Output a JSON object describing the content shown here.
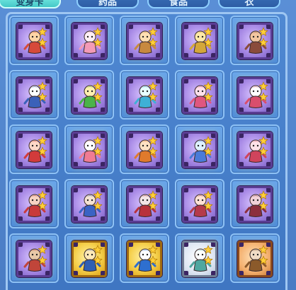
{
  "tabs": [
    {
      "label": "变身卡",
      "active": true
    },
    {
      "label": "药品",
      "active": false
    },
    {
      "label": "食品",
      "active": false
    },
    {
      "label": "衣",
      "active": false
    }
  ],
  "colors": {
    "accent_tab": "#45c9c8",
    "panel_bg": "#4f88d2",
    "card_purple": "#a98be6",
    "card_gold": "#f5cf4a",
    "star": "#ffcf3a"
  },
  "cards": [
    {
      "name": "char-red-warrior",
      "stars": 2,
      "style": "purple"
    },
    {
      "name": "char-pink-pig",
      "stars": 2,
      "style": "purple"
    },
    {
      "name": "char-monkey-king",
      "stars": 2,
      "style": "purple"
    },
    {
      "name": "char-golden-armor",
      "stars": 2,
      "style": "purple"
    },
    {
      "name": "char-horned-beast",
      "stars": 2,
      "style": "purple"
    },
    {
      "name": "char-white-hair-hero",
      "stars": 2,
      "style": "purple"
    },
    {
      "name": "char-green-fairy",
      "stars": 2,
      "style": "purple"
    },
    {
      "name": "char-blue-fairy",
      "stars": 2,
      "style": "purple"
    },
    {
      "name": "char-pink-fairy",
      "stars": 2,
      "style": "purple"
    },
    {
      "name": "char-bunny-girl",
      "stars": 2,
      "style": "purple"
    },
    {
      "name": "char-red-dancer",
      "stars": 2,
      "style": "purple"
    },
    {
      "name": "char-white-rabbit",
      "stars": 2,
      "style": "purple"
    },
    {
      "name": "char-fox-girl",
      "stars": 2,
      "style": "purple"
    },
    {
      "name": "char-blue-cat",
      "stars": 2,
      "style": "purple"
    },
    {
      "name": "char-red-bunny",
      "stars": 2,
      "style": "purple"
    },
    {
      "name": "char-red-bird",
      "stars": 2,
      "style": "purple"
    },
    {
      "name": "char-blue-bull",
      "stars": 2,
      "style": "purple"
    },
    {
      "name": "char-bat-girl",
      "stars": 2,
      "style": "purple"
    },
    {
      "name": "char-red-bat",
      "stars": 2,
      "style": "purple"
    },
    {
      "name": "char-dark-bat",
      "stars": 2,
      "style": "purple"
    },
    {
      "name": "char-red-monster",
      "stars": 2,
      "style": "purple"
    },
    {
      "name": "char-blue-knight",
      "stars": 2,
      "style": "gold"
    },
    {
      "name": "char-golden-knight",
      "stars": 2,
      "style": "gold"
    },
    {
      "name": "char-white-warrior",
      "stars": 2,
      "style": "light"
    },
    {
      "name": "char-bear",
      "stars": 2,
      "style": "orange"
    }
  ]
}
